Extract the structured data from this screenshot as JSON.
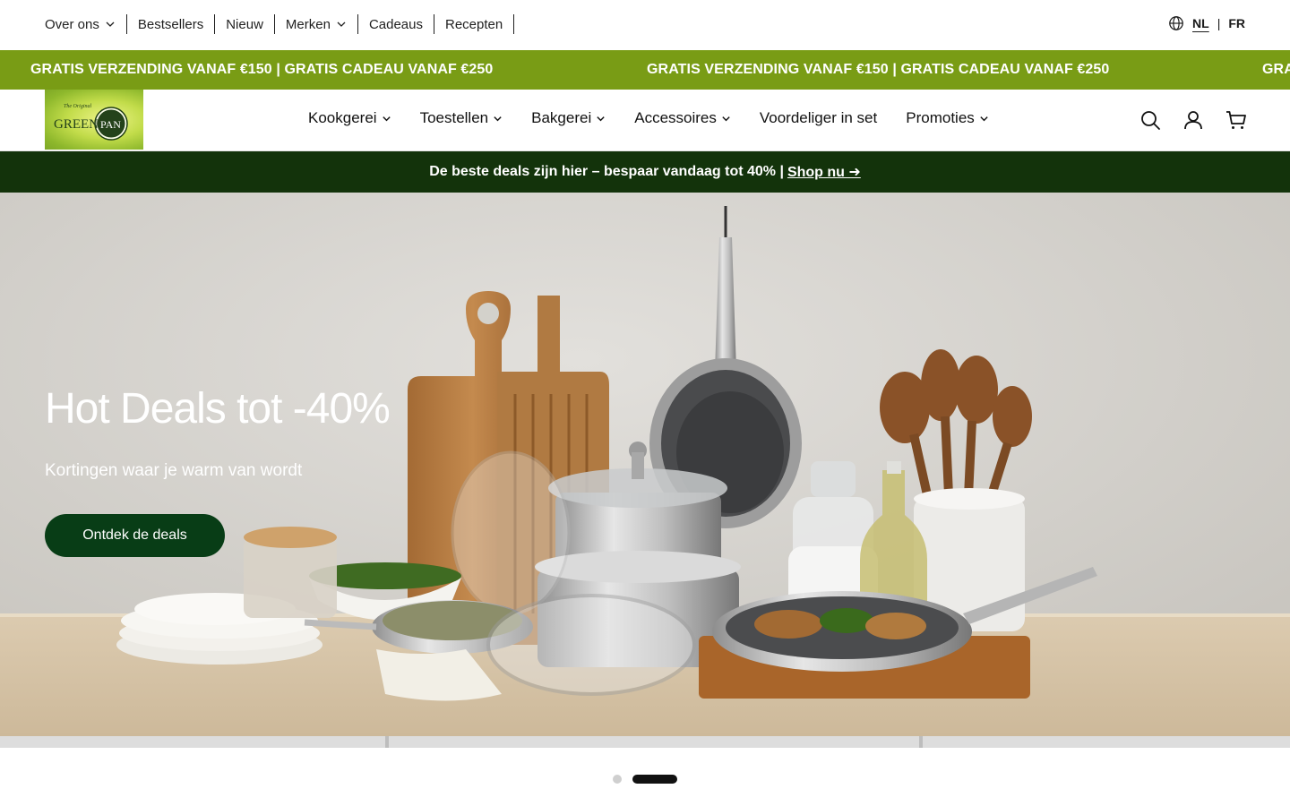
{
  "util_nav": {
    "items": [
      {
        "label": "Over ons",
        "has_dropdown": true
      },
      {
        "label": "Bestsellers",
        "has_dropdown": false
      },
      {
        "label": "Nieuw",
        "has_dropdown": false
      },
      {
        "label": "Merken",
        "has_dropdown": true
      },
      {
        "label": "Cadeaus",
        "has_dropdown": false
      },
      {
        "label": "Recepten",
        "has_dropdown": false
      }
    ],
    "language": {
      "icon": "globe-icon",
      "active": "NL",
      "separator": "|",
      "other": "FR"
    }
  },
  "marquee": {
    "text": "GRATIS VERZENDING VANAF €150 | GRATIS CADEAU VANAF €250",
    "text_partial": "GRA",
    "color": "#799c15"
  },
  "header": {
    "logo": {
      "small_text": "The Original",
      "brand_left": "GREEN",
      "brand_right": "PAN"
    },
    "nav": [
      {
        "label": "Kookgerei",
        "has_dropdown": true
      },
      {
        "label": "Toestellen",
        "has_dropdown": true
      },
      {
        "label": "Bakgerei",
        "has_dropdown": true
      },
      {
        "label": "Accessoires",
        "has_dropdown": true
      },
      {
        "label": "Voordeliger in set",
        "has_dropdown": false
      },
      {
        "label": "Promoties",
        "has_dropdown": true
      }
    ],
    "icons": [
      "search-icon",
      "account-icon",
      "cart-icon"
    ]
  },
  "promo_bar": {
    "text": "De beste deals zijn hier – bespaar vandaag tot 40% |",
    "link": "Shop nu ➜",
    "color": "#13330b"
  },
  "hero": {
    "title": "Hot Deals tot -40%",
    "subtitle": "Kortingen waar je warm van wordt",
    "cta": "Ontdek de deals",
    "cta_color": "#083d16"
  },
  "slider": {
    "count": 2,
    "active_index": 1
  }
}
